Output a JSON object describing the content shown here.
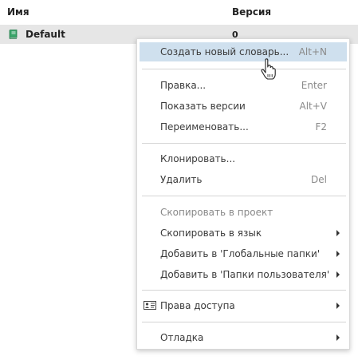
{
  "table": {
    "columns": {
      "name": "Имя",
      "version": "Версия"
    },
    "rows": [
      {
        "name": "Default",
        "version": "0",
        "icon": "book-icon"
      }
    ]
  },
  "menu": {
    "items": {
      "create": {
        "label": "Создать новый словарь...",
        "shortcut": "Alt+N"
      },
      "edit": {
        "label": "Правка...",
        "shortcut": "Enter"
      },
      "versions": {
        "label": "Показать версии",
        "shortcut": "Alt+V"
      },
      "rename": {
        "label": "Переименовать...",
        "shortcut": "F2"
      },
      "clone": {
        "label": "Клонировать...",
        "shortcut": ""
      },
      "delete": {
        "label": "Удалить",
        "shortcut": "Del"
      },
      "copy_project": {
        "label": "Скопировать в проект",
        "disabled": true
      },
      "copy_language": {
        "label": "Скопировать в язык"
      },
      "add_global": {
        "label": "Добавить в 'Глобальные папки'"
      },
      "add_user": {
        "label": "Добавить в 'Папки пользователя'"
      },
      "access": {
        "label": "Права доступа",
        "icon": "id-card-icon"
      },
      "debug": {
        "label": "Отладка"
      }
    }
  },
  "colors": {
    "highlight": "#cfe0ee",
    "row_selected": "#e6e6e6",
    "book_icon": "#3aa56a"
  }
}
